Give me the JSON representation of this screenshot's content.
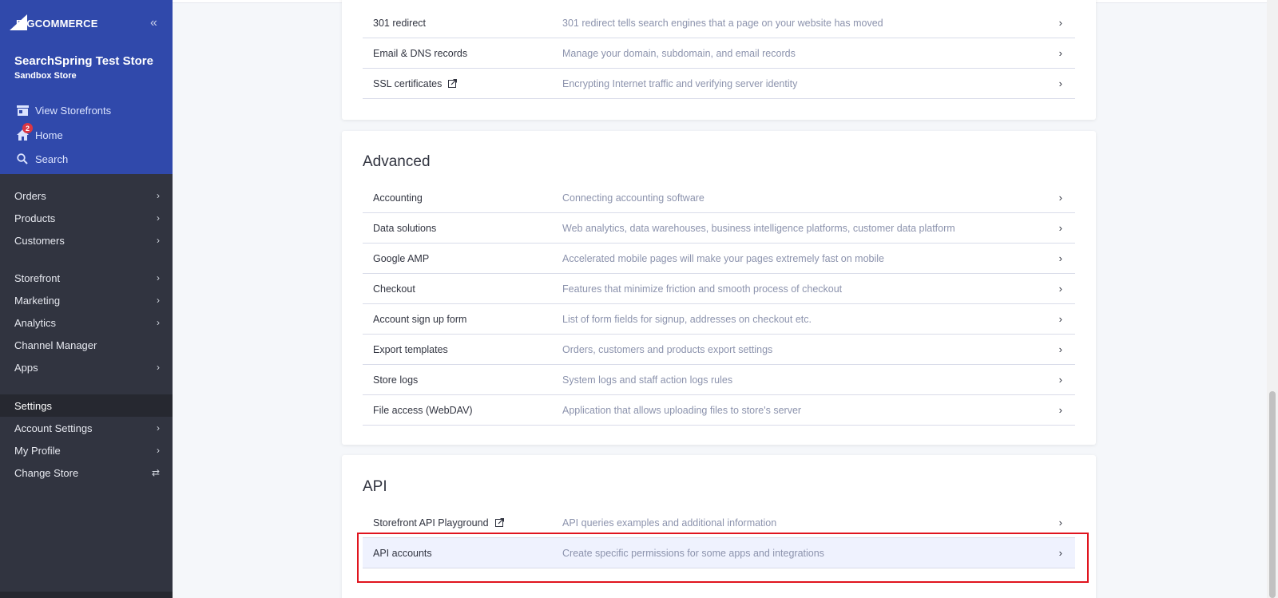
{
  "brand": {
    "logo_text": "BIGCOMMERCE",
    "accent": "#3049ab"
  },
  "store": {
    "name": "SearchSpring Test Store",
    "type": "Sandbox Store"
  },
  "top_links": [
    {
      "label": "View Storefronts",
      "icon": "storefront-icon"
    },
    {
      "label": "Home",
      "icon": "home-icon",
      "badge": "2"
    },
    {
      "label": "Search",
      "icon": "search-icon"
    }
  ],
  "nav": {
    "orders": "Orders",
    "products": "Products",
    "customers": "Customers",
    "storefront": "Storefront",
    "marketing": "Marketing",
    "analytics": "Analytics",
    "channel_manager": "Channel Manager",
    "apps": "Apps",
    "settings": "Settings",
    "account_settings": "Account Settings",
    "my_profile": "My Profile",
    "change_store": "Change Store"
  },
  "section_top": {
    "rows": [
      {
        "name": "301 redirect",
        "desc": "301 redirect tells search engines that a page on your website has moved"
      },
      {
        "name": "Email & DNS records",
        "desc": "Manage your domain, subdomain, and email records"
      },
      {
        "name": "SSL certificates",
        "desc": "Encrypting Internet traffic and verifying server identity",
        "external": true
      }
    ]
  },
  "section_advanced": {
    "title": "Advanced",
    "rows": [
      {
        "name": "Accounting",
        "desc": "Connecting accounting software"
      },
      {
        "name": "Data solutions",
        "desc": "Web analytics, data warehouses, business intelligence platforms, customer data platform"
      },
      {
        "name": "Google AMP",
        "desc": "Accelerated mobile pages will make your pages extremely fast on mobile"
      },
      {
        "name": "Checkout",
        "desc": "Features that minimize friction and smooth process of checkout"
      },
      {
        "name": "Account sign up form",
        "desc": "List of form fields for signup, addresses on checkout etc."
      },
      {
        "name": "Export templates",
        "desc": "Orders, customers and products export settings"
      },
      {
        "name": "Store logs",
        "desc": "System logs and staff action logs rules"
      },
      {
        "name": "File access (WebDAV)",
        "desc": "Application that allows uploading files to store's server"
      }
    ]
  },
  "section_api": {
    "title": "API",
    "rows": [
      {
        "name": "Storefront API Playground",
        "desc": "API queries examples and additional information",
        "external": true
      },
      {
        "name": "API accounts",
        "desc": "Create specific permissions for some apps and integrations"
      }
    ]
  },
  "colors": {
    "highlight_box": "#e0141e",
    "sidebar_bg": "#313440",
    "sidebar_top": "#3049ab"
  }
}
